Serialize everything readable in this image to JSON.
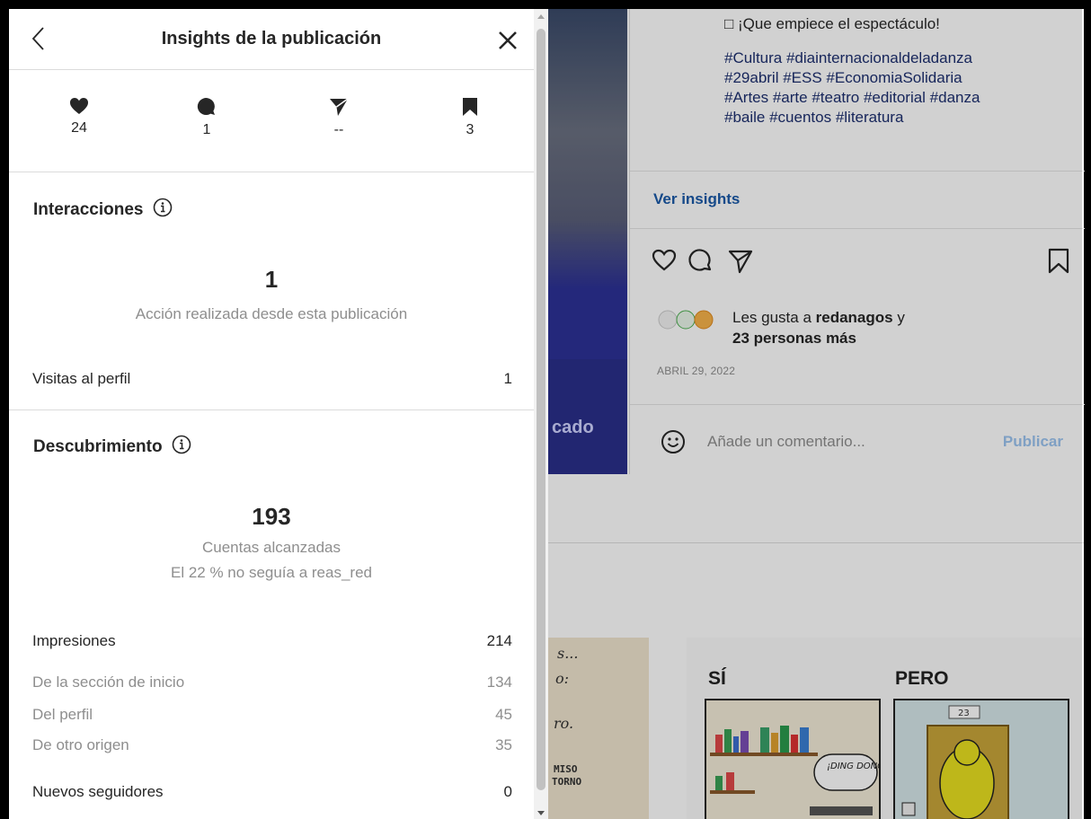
{
  "modal": {
    "title": "Insights de la publicación",
    "stats": [
      {
        "icon": "heart-icon",
        "value": "24"
      },
      {
        "icon": "comment-icon",
        "value": "1"
      },
      {
        "icon": "share-icon",
        "value": "--"
      },
      {
        "icon": "bookmark-icon",
        "value": "3"
      }
    ],
    "interactions": {
      "heading": "Interacciones",
      "big_value": "1",
      "big_caption": "Acción realizada desde esta publicación",
      "profile_visits_label": "Visitas al perfil",
      "profile_visits_value": "1"
    },
    "discovery": {
      "heading": "Descubrimiento",
      "big_value": "193",
      "caption1": "Cuentas alcanzadas",
      "caption2": "El 22 % no seguía a reas_red",
      "impressions_label": "Impresiones",
      "impressions_value": "214",
      "breakdown": [
        {
          "label": "De la sección de inicio",
          "value": "134"
        },
        {
          "label": "Del perfil",
          "value": "45"
        },
        {
          "label": "De otro origen",
          "value": "35"
        }
      ],
      "followers_label": "Nuevos seguidores",
      "followers_value": "0"
    }
  },
  "post": {
    "caption_first": "□ ¡Que empiece el espectáculo!",
    "hashtags": [
      "#Cultura #diainternacionaldeladanza",
      "#29abril #ESS #EconomiaSolidaria",
      "#Artes #arte #teatro #editorial #danza",
      "#baile #cuentos #literatura"
    ],
    "view_insights": "Ver insights",
    "likes_prefix": "Les gusta a ",
    "likes_user": "redanagos",
    "likes_suffix": " y",
    "likes_others": "23 personas más",
    "date": "ABRIL 29, 2022",
    "comment_placeholder": "Añade un comentario...",
    "publish_label": "Publicar",
    "image_text": "cado"
  },
  "comic": {
    "left_label": "SÍ",
    "right_label": "PERO",
    "bubble": "¡DING DONG!",
    "door_number": "23"
  },
  "colors": {
    "link": "#1a5aa8",
    "publish": "#9cc4ef",
    "muted": "#8e8e8e",
    "text": "#262626"
  }
}
